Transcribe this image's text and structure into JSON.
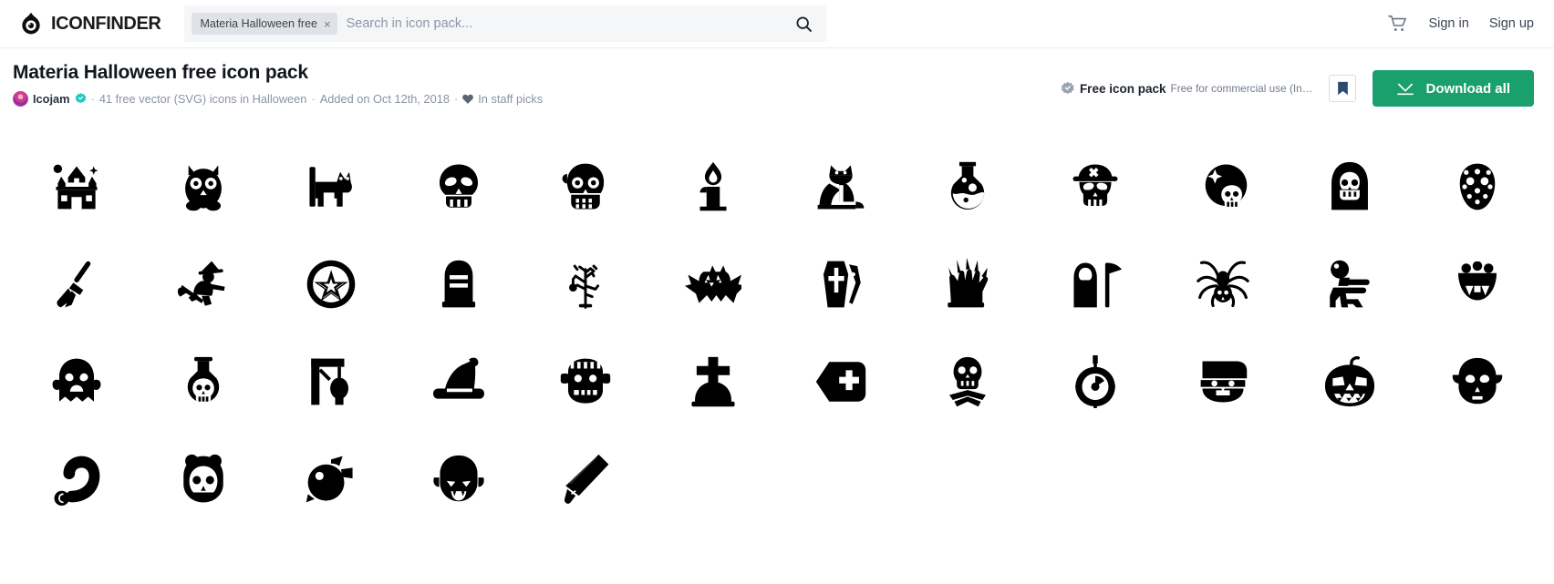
{
  "header": {
    "brand_name": "ICONFINDER",
    "brand_icon": "iconfinder-eye-logo",
    "search": {
      "chip_label": "Materia Halloween free",
      "chip_remove_icon": "close-icon",
      "placeholder": "Search in icon pack...",
      "value": "",
      "search_icon": "search-icon"
    },
    "cart_icon": "shopping-cart-icon",
    "sign_in_label": "Sign in",
    "sign_up_label": "Sign up"
  },
  "pack": {
    "title": "Materia Halloween free icon pack",
    "author": "Icojam",
    "author_avatar": "user-avatar",
    "verified_icon": "verified-badge-icon",
    "sep": "·",
    "counts_text": "41 free vector (SVG) icons in Halloween",
    "added_text": "Added on Oct 12th, 2018",
    "heart_icon": "heart-icon",
    "staff_picks_text": "In staff picks",
    "free_badge": {
      "icon": "verified-seal-icon",
      "title": "Free icon pack",
      "subtitle": "Free for commercial use (Include..."
    },
    "bookmark_icon": "bookmark-icon",
    "download_icon": "download-arrow-icon",
    "download_label": "Download all",
    "accent_color": "#1aa06d",
    "icon_color": "#000000"
  },
  "icons": [
    {
      "name": "haunted-house-icon"
    },
    {
      "name": "owl-icon"
    },
    {
      "name": "standing-cat-icon"
    },
    {
      "name": "skull-icon"
    },
    {
      "name": "zombie-skull-icon"
    },
    {
      "name": "candle-icon"
    },
    {
      "name": "sitting-cat-icon"
    },
    {
      "name": "potion-flask-icon"
    },
    {
      "name": "pirate-skull-icon"
    },
    {
      "name": "moon-skull-icon"
    },
    {
      "name": "grim-reaper-hood-icon"
    },
    {
      "name": "hockey-mask-icon"
    },
    {
      "name": "broom-icon"
    },
    {
      "name": "flying-witch-icon"
    },
    {
      "name": "pentagram-icon"
    },
    {
      "name": "tombstone-icon"
    },
    {
      "name": "dead-tree-icon"
    },
    {
      "name": "bat-icon"
    },
    {
      "name": "coffin-icon"
    },
    {
      "name": "zombie-hand-icon"
    },
    {
      "name": "reaper-scythe-icon"
    },
    {
      "name": "spider-icon"
    },
    {
      "name": "walking-zombie-icon"
    },
    {
      "name": "vampire-teeth-icon"
    },
    {
      "name": "ghost-icon"
    },
    {
      "name": "poison-bottle-icon"
    },
    {
      "name": "gallows-icon"
    },
    {
      "name": "witch-hat-icon"
    },
    {
      "name": "frankenstein-icon"
    },
    {
      "name": "grave-cross-icon"
    },
    {
      "name": "first-aid-tag-icon"
    },
    {
      "name": "skeleton-icon"
    },
    {
      "name": "bomb-icon"
    },
    {
      "name": "mummy-face-icon"
    },
    {
      "name": "jack-o-lantern-icon"
    },
    {
      "name": "ghoul-face-icon"
    },
    {
      "name": "lollipop-icon"
    },
    {
      "name": "skull-mask-icon"
    },
    {
      "name": "wrapped-candy-icon"
    },
    {
      "name": "vampire-face-icon"
    },
    {
      "name": "cleaver-knife-icon"
    }
  ]
}
